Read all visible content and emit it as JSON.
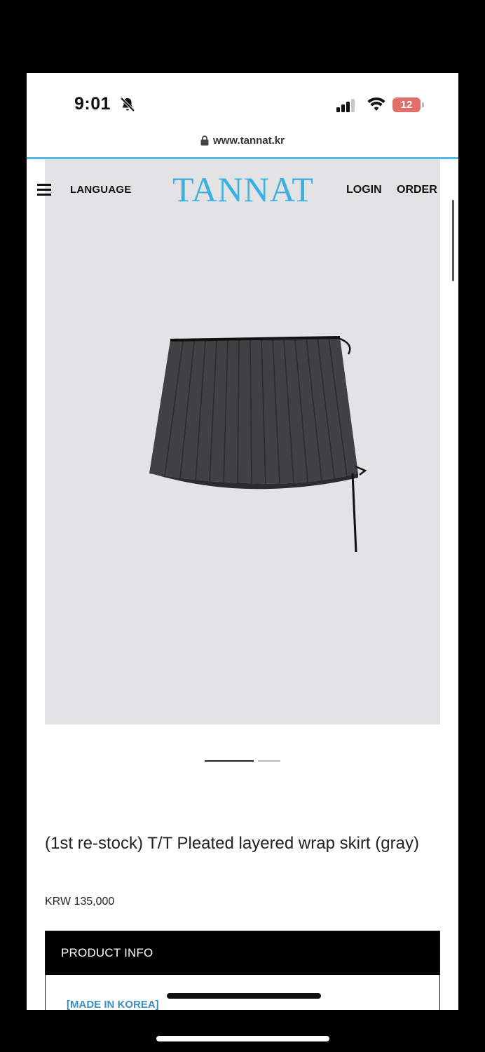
{
  "status": {
    "time": "9:01",
    "battery": "12"
  },
  "browser": {
    "url": "www.tannat.kr"
  },
  "header": {
    "language": "LANGUAGE",
    "logo": "TANNAT",
    "login": "LOGIN",
    "order": "ORDER"
  },
  "carousel": {
    "current_slide": 1,
    "total_slides": 2
  },
  "product": {
    "title": "(1st re-stock) T/T Pleated layered wrap skirt (gray)",
    "price": "KRW 135,000",
    "info_header": "PRODUCT INFO",
    "info_note": "[MADE IN KOREA]"
  },
  "colors": {
    "brand": "#3ab0e0",
    "hero_bg": "#e3e3e5",
    "skirt": "#3f4144",
    "battery": "#e26e6a"
  },
  "icons": [
    "bell-slash-icon",
    "signal-icon",
    "wifi-icon",
    "battery-icon",
    "lock-icon",
    "hamburger-menu-icon"
  ]
}
